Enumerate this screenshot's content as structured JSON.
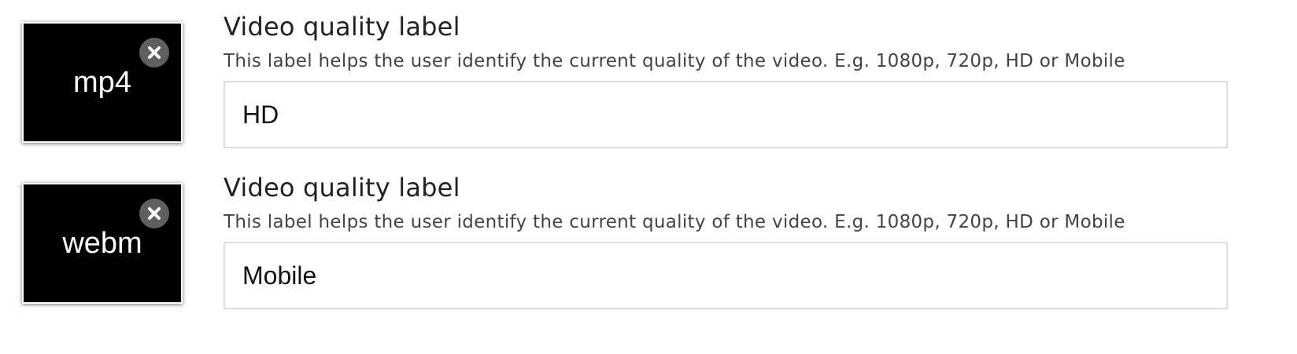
{
  "quality_items": [
    {
      "file_type": "mp4",
      "remove_icon": "close-circle-icon",
      "title": "Video quality label",
      "description": "This label helps the user identify the current quality of the video. E.g. 1080p, 720p, HD or Mobile",
      "value": "HD"
    },
    {
      "file_type": "webm",
      "remove_icon": "close-circle-icon",
      "title": "Video quality label",
      "description": "This label helps the user identify the current quality of the video. E.g. 1080p, 720p, HD or Mobile",
      "value": "Mobile"
    }
  ],
  "colors": {
    "thumbnail_bg": "#000000",
    "remove_button_bg": "#5f5f5f",
    "input_border": "#dddddd"
  }
}
